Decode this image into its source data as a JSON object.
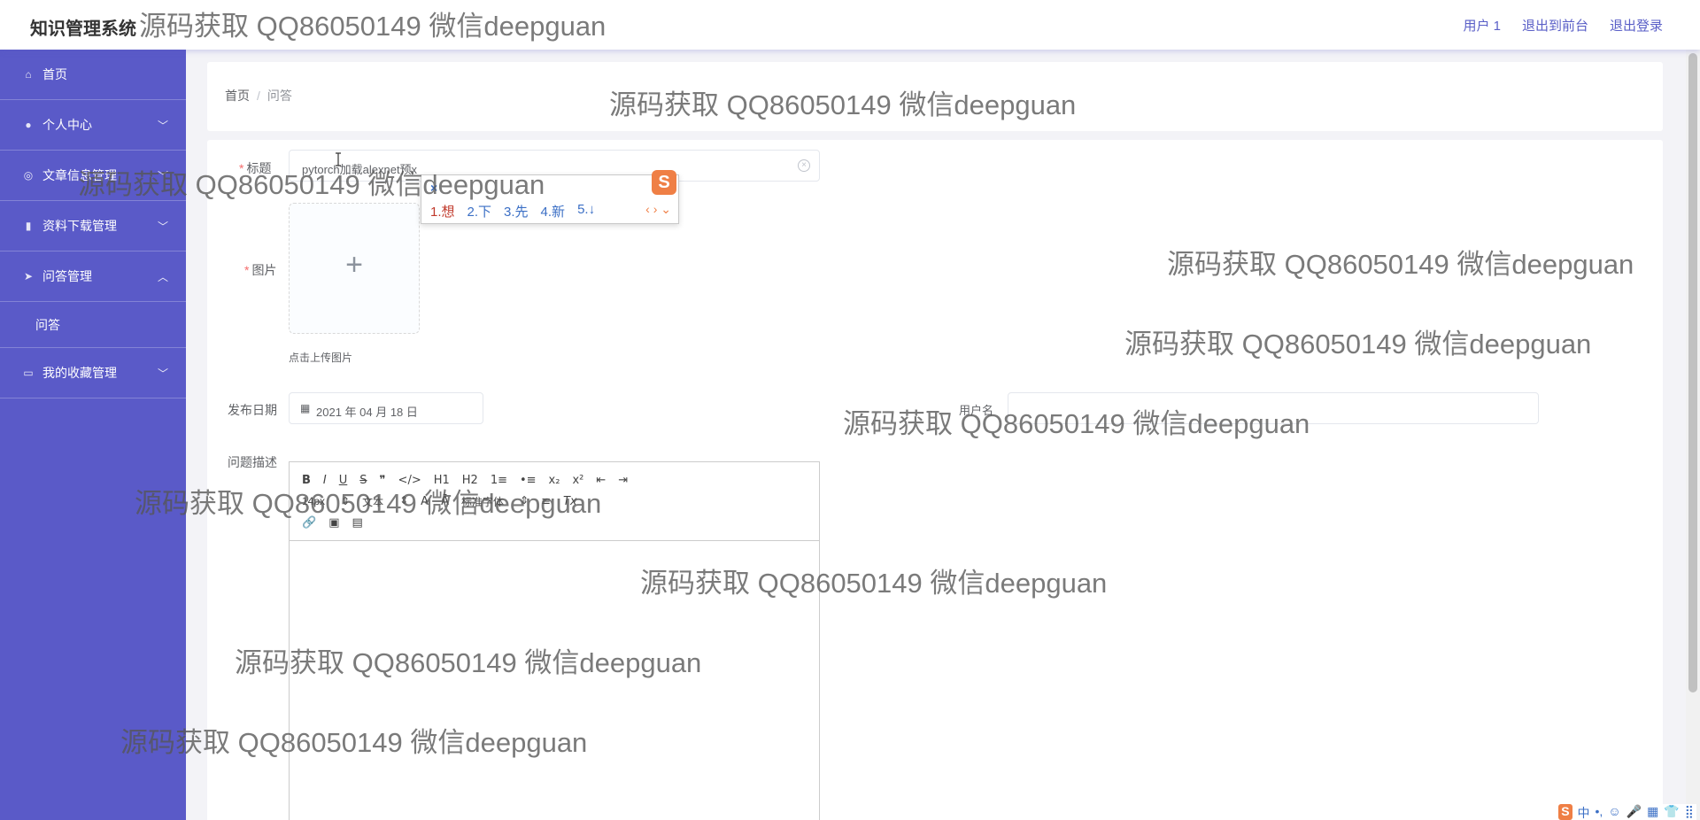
{
  "header": {
    "app_title": "知识管理系统",
    "user": "用户 1",
    "to_front": "退出到前台",
    "logout": "退出登录"
  },
  "sidebar": {
    "items": [
      {
        "label": "首页",
        "icon": "home-icon"
      },
      {
        "label": "个人中心",
        "icon": "user-icon"
      },
      {
        "label": "文章信息管理",
        "icon": "compass-icon"
      },
      {
        "label": "资料下载管理",
        "icon": "chart-icon"
      },
      {
        "label": "问答管理",
        "icon": "send-icon"
      },
      {
        "label": "问答"
      },
      {
        "label": "我的收藏管理",
        "icon": "screen-icon"
      }
    ]
  },
  "breadcrumb": {
    "home": "首页",
    "separator": "/",
    "current": "问答"
  },
  "form": {
    "title_label": "标题",
    "title_value": "pytorch加载alexnet预x",
    "image_label": "图片",
    "upload_hint": "点击上传图片",
    "date_label": "发布日期",
    "date_value": "2021 年 04 月 18 日",
    "username_label": "用户名",
    "desc_label": "问题描述"
  },
  "ime_popup": {
    "close": "×",
    "logo": "S",
    "candidates": [
      "1.想",
      "2.下",
      "3.先",
      "4.新",
      "5.↓"
    ],
    "nav": "‹ › ⌄"
  },
  "editor": {
    "row1": [
      "B",
      "I",
      "U",
      "S",
      "❞",
      "</>",
      "H1",
      "H2",
      "1≡",
      "•≡",
      "x₂",
      "x²",
      "⇤",
      "⇥"
    ],
    "size_select": "14px",
    "text_select": "文本",
    "font_select": "标准字体",
    "row3": [
      "🔗",
      "▣",
      "▤"
    ]
  },
  "ime_bar": {
    "logo": "S",
    "items": [
      "中",
      "•,",
      "☺",
      "🎤",
      "▦",
      "👕",
      "⣿"
    ]
  },
  "watermark": "源码获取 QQ86050149 微信deepguan"
}
